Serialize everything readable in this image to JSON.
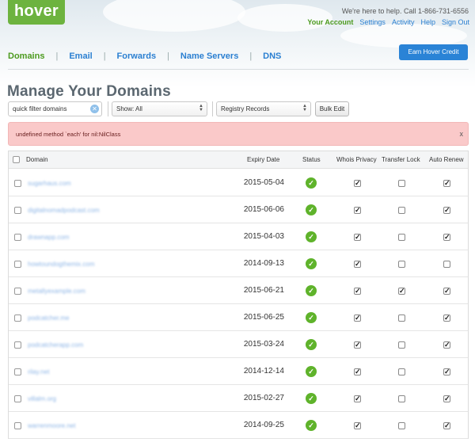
{
  "header": {
    "logo": "hover",
    "help_text": "We're here to help. Call 1-866-731-6556",
    "account_nav": [
      "Your Account",
      "Settings",
      "Activity",
      "Help",
      "Sign Out"
    ]
  },
  "main_nav": {
    "tabs": [
      "Domains",
      "Email",
      "Forwards",
      "Name Servers",
      "DNS"
    ],
    "active": "Domains",
    "earn_button": "Earn Hover Credit"
  },
  "page_title": "Manage Your Domains",
  "toolbar": {
    "filter_placeholder": "quick filter domains",
    "show_select": "Show: All",
    "records_select": "Registry Records",
    "bulk_edit": "Bulk Edit"
  },
  "error": {
    "message": "undefined method `each' for nil:NilClass",
    "close": "x"
  },
  "table": {
    "columns": [
      "Domain",
      "Expiry Date",
      "Status",
      "Whois Privacy",
      "Transfer Lock",
      "Auto Renew"
    ],
    "rows": [
      {
        "domain": "sugarhaus.com",
        "expiry": "2015-05-04",
        "whois": true,
        "lock": false,
        "renew": true
      },
      {
        "domain": "digitalnomadpodcast.com",
        "expiry": "2015-06-06",
        "whois": true,
        "lock": false,
        "renew": true
      },
      {
        "domain": "drawnapp.com",
        "expiry": "2015-04-03",
        "whois": true,
        "lock": false,
        "renew": true
      },
      {
        "domain": "howtoundogthemix.com",
        "expiry": "2014-09-13",
        "whois": true,
        "lock": false,
        "renew": false
      },
      {
        "domain": "metallyexample.com",
        "expiry": "2015-06-21",
        "whois": true,
        "lock": true,
        "renew": true
      },
      {
        "domain": "podcatcher.me",
        "expiry": "2015-06-25",
        "whois": true,
        "lock": false,
        "renew": true
      },
      {
        "domain": "podcatcherapp.com",
        "expiry": "2015-03-24",
        "whois": true,
        "lock": false,
        "renew": true
      },
      {
        "domain": "rilay.net",
        "expiry": "2014-12-14",
        "whois": true,
        "lock": false,
        "renew": true
      },
      {
        "domain": "villalm.org",
        "expiry": "2015-02-27",
        "whois": true,
        "lock": false,
        "renew": true
      },
      {
        "domain": "warrenmoore.net",
        "expiry": "2014-09-25",
        "whois": true,
        "lock": false,
        "renew": true
      }
    ]
  },
  "colors": {
    "brand_green": "#6db33f",
    "link_blue": "#2a7fd1",
    "error_bg": "#fac9c9",
    "status_ok": "#5fb32b"
  }
}
